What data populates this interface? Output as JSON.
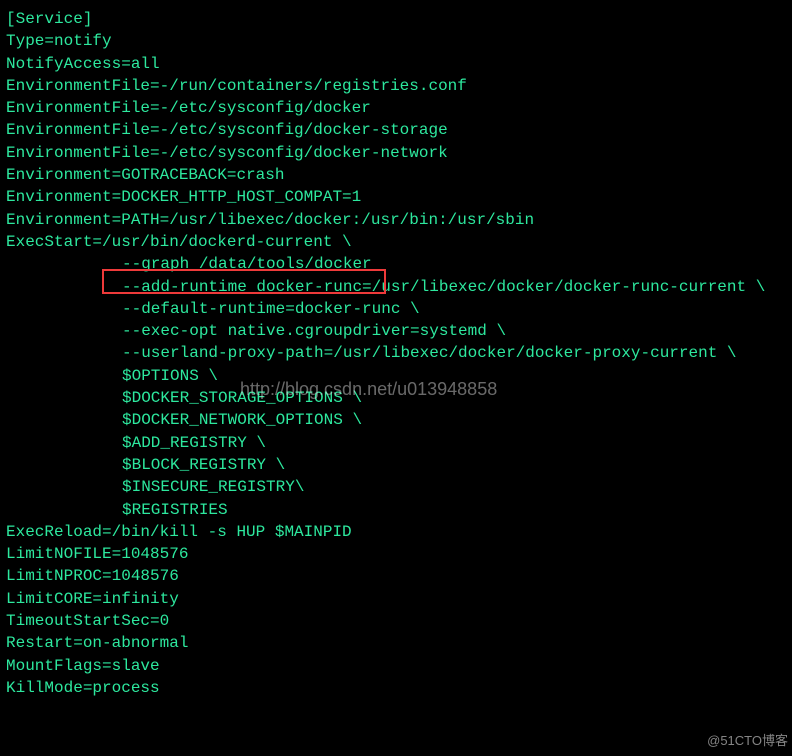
{
  "lines": {
    "l0": "[Service]",
    "l1": "Type=notify",
    "l2": "NotifyAccess=all",
    "l3": "EnvironmentFile=-/run/containers/registries.conf",
    "l4": "EnvironmentFile=-/etc/sysconfig/docker",
    "l5": "EnvironmentFile=-/etc/sysconfig/docker-storage",
    "l6": "EnvironmentFile=-/etc/sysconfig/docker-network",
    "l7": "Environment=GOTRACEBACK=crash",
    "l8": "Environment=DOCKER_HTTP_HOST_COMPAT=1",
    "l9": "Environment=PATH=/usr/libexec/docker:/usr/bin:/usr/sbin",
    "l10": "ExecStart=/usr/bin/dockerd-current \\",
    "l11": "--graph /data/tools/docker",
    "l12": "--add-runtime docker-runc=/usr/libexec/docker/docker-runc-current \\",
    "l13": "--default-runtime=docker-runc \\",
    "l14": "--exec-opt native.cgroupdriver=systemd \\",
    "l15": "--userland-proxy-path=/usr/libexec/docker/docker-proxy-current \\",
    "l16": "$OPTIONS \\",
    "l17": "$DOCKER_STORAGE_OPTIONS \\",
    "l18": "$DOCKER_NETWORK_OPTIONS \\",
    "l19": "$ADD_REGISTRY \\",
    "l20": "$BLOCK_REGISTRY \\",
    "l21": "$INSECURE_REGISTRY\\",
    "l22": "$REGISTRIES",
    "l23": "ExecReload=/bin/kill -s HUP $MAINPID",
    "l24": "LimitNOFILE=1048576",
    "l25": "LimitNPROC=1048576",
    "l26": "LimitCORE=infinity",
    "l27": "TimeoutStartSec=0",
    "l28": "Restart=on-abnormal",
    "l29": "MountFlags=slave",
    "l30": "KillMode=process"
  },
  "watermark_center": "http://blog.csdn.net/u013948858",
  "watermark_br": "@51CTO博客"
}
